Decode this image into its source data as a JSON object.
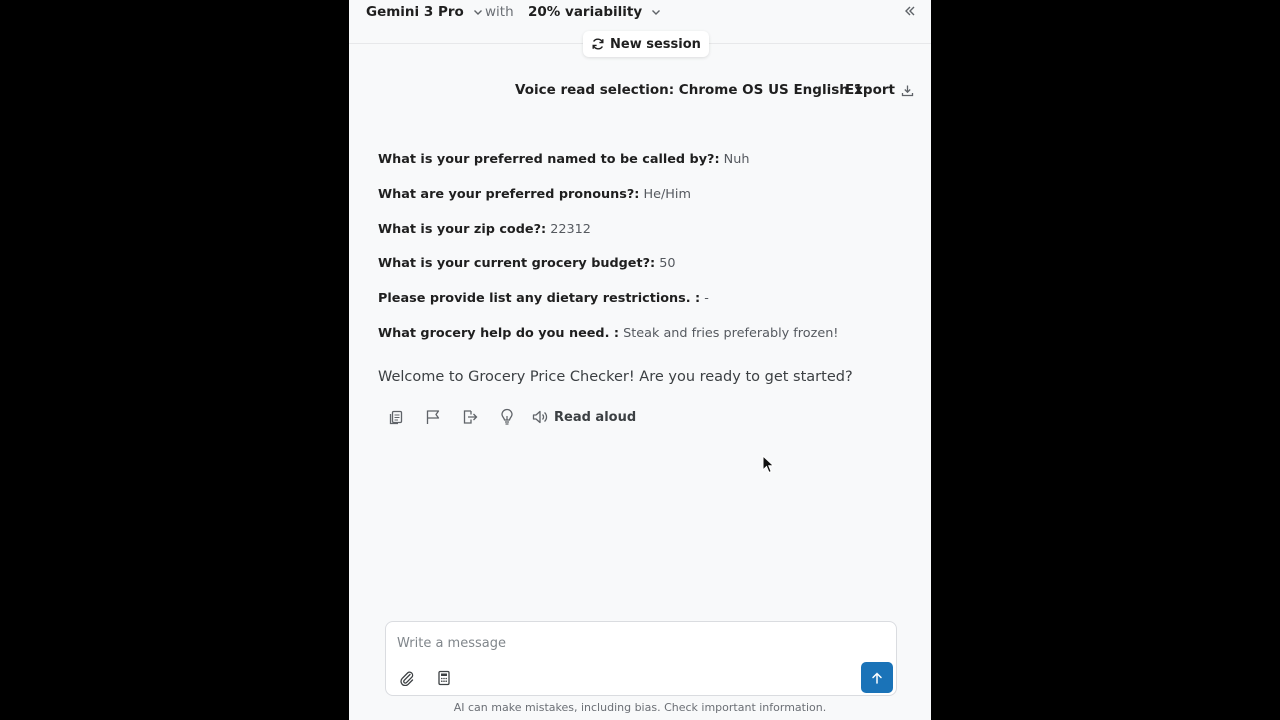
{
  "header": {
    "model": "Gemini 3 Pro",
    "with_label": "with",
    "variability": "20% variability",
    "new_session_label": "New session"
  },
  "toolbar": {
    "voice_selection": "Voice read selection: Chrome OS US English 1",
    "export_label": "Export"
  },
  "profile": [
    {
      "question": "What is your preferred named to be called by?:",
      "answer": "Nuh"
    },
    {
      "question": "What are your preferred pronouns?:",
      "answer": "He/Him"
    },
    {
      "question": "What is your zip code?:",
      "answer": "22312"
    },
    {
      "question": "What is your current grocery budget?:",
      "answer": "50"
    },
    {
      "question": "Please provide list any dietary restrictions. :",
      "answer": "-"
    },
    {
      "question": "What grocery help do you need. :",
      "answer": "Steak and fries preferably frozen!"
    }
  ],
  "message": {
    "text": "Welcome to Grocery Price Checker! Are you ready to get started?",
    "read_aloud_label": "Read aloud"
  },
  "composer": {
    "placeholder": "Write a message",
    "value": ""
  },
  "footer": {
    "disclaimer": "AI can make mistakes, including bias. Check important information."
  },
  "colors": {
    "panel_bg": "#f8f9fa",
    "send_button": "#1a73b8",
    "page_bg": "#000000"
  }
}
